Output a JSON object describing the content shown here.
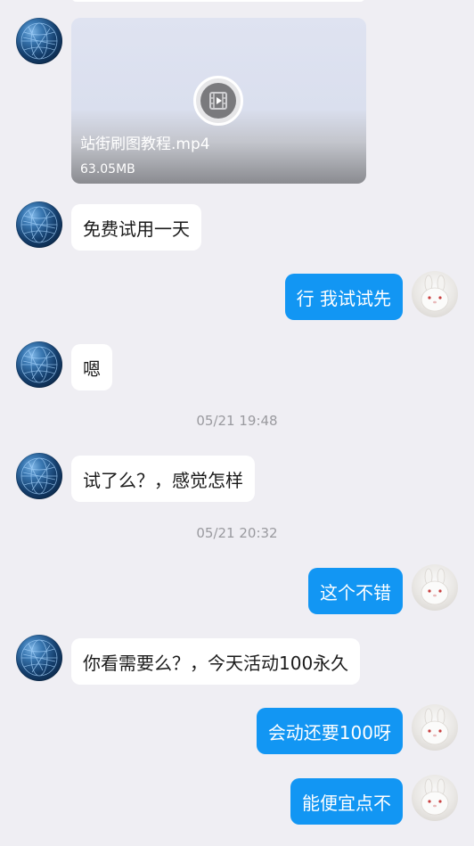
{
  "messages": [
    {
      "id": "m1",
      "type": "video",
      "direction": "in",
      "file_name": "站街刷图教程.mp4",
      "file_size": "63.05MB"
    },
    {
      "id": "m2",
      "type": "text",
      "direction": "in",
      "text": "免费试用一天"
    },
    {
      "id": "m3",
      "type": "text",
      "direction": "out",
      "text": "行 我试试先"
    },
    {
      "id": "m4",
      "type": "text",
      "direction": "in",
      "text": "嗯"
    },
    {
      "id": "t1",
      "type": "timestamp",
      "text": "05/21 19:48"
    },
    {
      "id": "m5",
      "type": "text",
      "direction": "in",
      "text": "试了么？，感觉怎样"
    },
    {
      "id": "t2",
      "type": "timestamp",
      "text": "05/21 20:32"
    },
    {
      "id": "m6",
      "type": "text",
      "direction": "out",
      "text": "这个不错"
    },
    {
      "id": "m7",
      "type": "text",
      "direction": "in",
      "text": "你看需要么？，今天活动100永久"
    },
    {
      "id": "m8",
      "type": "text",
      "direction": "out",
      "text": "会动还要100呀"
    },
    {
      "id": "m9",
      "type": "text",
      "direction": "out",
      "text": "能便宜点不"
    }
  ],
  "avatars": {
    "incoming": "globe-avatar-icon",
    "outgoing": "rabbit-avatar-icon"
  },
  "colors": {
    "background": "#efeef3",
    "incoming_bubble": "#ffffff",
    "outgoing_bubble": "#1296f3",
    "timestamp_text": "#9a9a9f"
  }
}
